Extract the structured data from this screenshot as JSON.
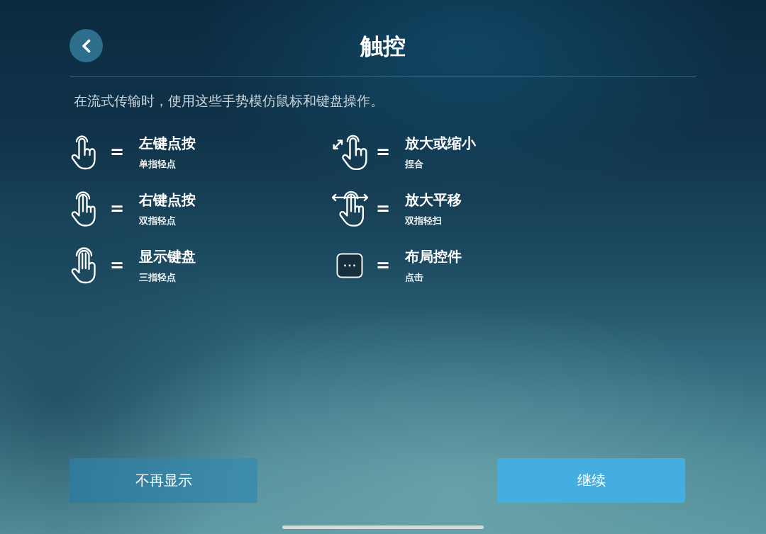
{
  "header": {
    "title": "触控"
  },
  "description": "在流式传输时，使用这些手势模仿鼠标和键盘操作。",
  "gestures": [
    {
      "kind": "tap-one",
      "separator": "=",
      "action": "左键点按",
      "gesture": "单指轻点"
    },
    {
      "kind": "pinch",
      "separator": "=",
      "action": "放大或缩小",
      "gesture": "捏合"
    },
    {
      "kind": "tap-two",
      "separator": "=",
      "action": "右键点按",
      "gesture": "双指轻点"
    },
    {
      "kind": "pan",
      "separator": "=",
      "action": "放大平移",
      "gesture": "双指轻扫"
    },
    {
      "kind": "tap-three",
      "separator": "=",
      "action": "显示键盘",
      "gesture": "三指轻点"
    },
    {
      "kind": "layout",
      "separator": "=",
      "action": "布局控件",
      "gesture": "点击"
    }
  ],
  "buttons": [
    {
      "kind": "secondary",
      "label": "不再显示"
    },
    {
      "kind": "primary",
      "label": "继续"
    }
  ]
}
